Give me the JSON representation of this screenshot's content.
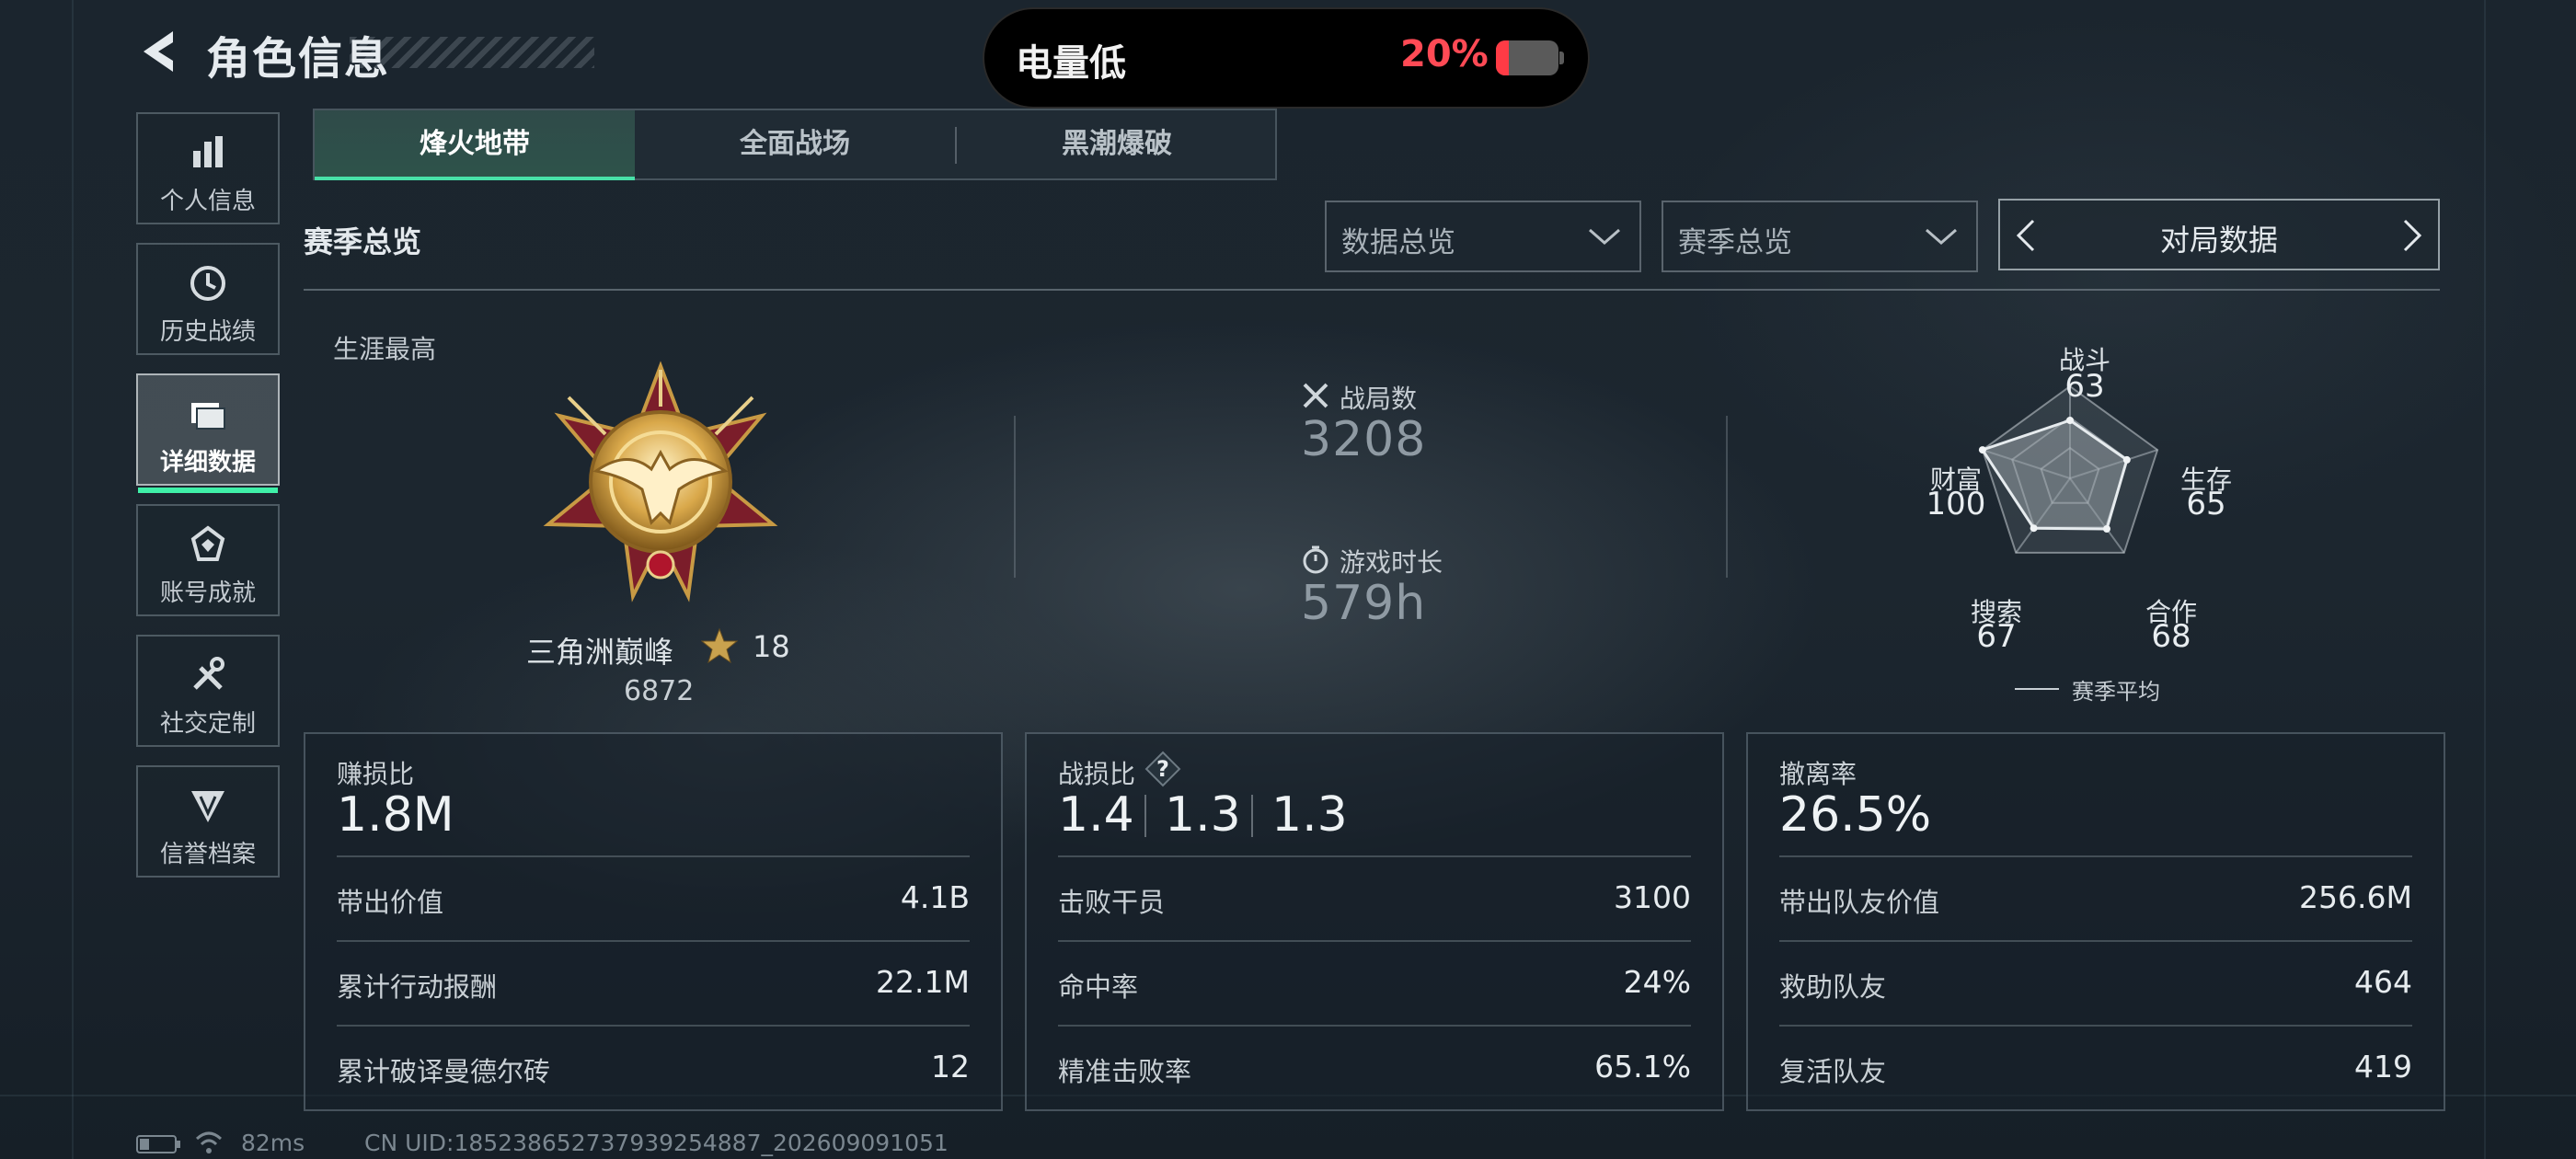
{
  "header": {
    "title": "角色信息"
  },
  "battery": {
    "label": "电量低",
    "percent": "20%",
    "level": 0.2,
    "color": "#ff4a55"
  },
  "sidebar": {
    "items": [
      {
        "label": "个人信息",
        "icon": "bar-chart-icon"
      },
      {
        "label": "历史战绩",
        "icon": "history-icon"
      },
      {
        "label": "详细数据",
        "icon": "files-icon",
        "active": true
      },
      {
        "label": "账号成就",
        "icon": "badge-icon"
      },
      {
        "label": "社交定制",
        "icon": "tools-icon"
      },
      {
        "label": "信誉档案",
        "icon": "shield-emblem-icon"
      }
    ]
  },
  "tabs": [
    "烽火地带",
    "全面战场",
    "黑潮爆破"
  ],
  "section": {
    "title": "赛季总览",
    "dropdown1": "数据总览",
    "dropdown2": "赛季总览",
    "pager": "对局数据"
  },
  "career": {
    "label": "生涯最高",
    "rank_name": "三角洲巅峰",
    "stars": "18",
    "score": "6872"
  },
  "stats": {
    "matches_label": "战局数",
    "matches": "3208",
    "playtime_label": "游戏时长",
    "playtime": "579h"
  },
  "radar": {
    "axes": [
      {
        "label": "战斗",
        "value": "63"
      },
      {
        "label": "生存",
        "value": "65"
      },
      {
        "label": "合作",
        "value": "68"
      },
      {
        "label": "搜索",
        "value": "67"
      },
      {
        "label": "财富",
        "value": "100"
      }
    ],
    "legend": "赛季平均"
  },
  "panels": [
    {
      "title": "赚损比",
      "big": "1.8M",
      "rows": [
        {
          "k": "带出价值",
          "v": "4.1B"
        },
        {
          "k": "累计行动报酬",
          "v": "22.1M"
        },
        {
          "k": "累计破译曼德尔砖",
          "v": "12"
        }
      ]
    },
    {
      "title": "战损比",
      "ratios": [
        "1.4",
        "1.3",
        "1.3"
      ],
      "help": "?",
      "rows": [
        {
          "k": "击败干员",
          "v": "3100"
        },
        {
          "k": "命中率",
          "v": "24%"
        },
        {
          "k": "精准击败率",
          "v": "65.1%"
        }
      ]
    },
    {
      "title": "撤离率",
      "big": "26.5%",
      "rows": [
        {
          "k": "带出队友价值",
          "v": "256.6M"
        },
        {
          "k": "救助队友",
          "v": "464"
        },
        {
          "k": "复活队友",
          "v": "419"
        }
      ]
    }
  ],
  "footer": {
    "ping": "82ms",
    "uid": "CN UID:18523865273793925488​7_202609091051"
  }
}
